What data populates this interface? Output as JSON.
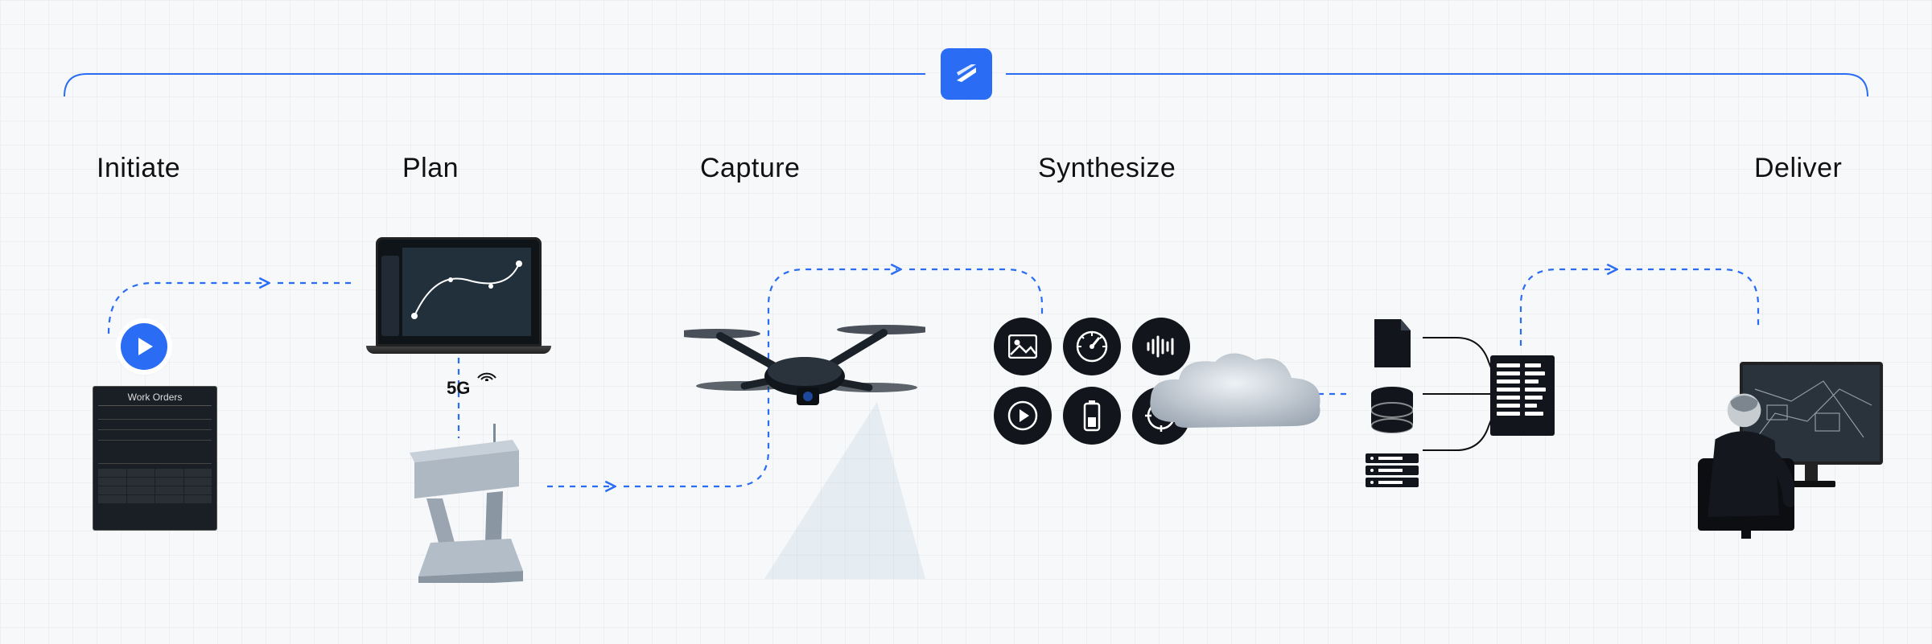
{
  "brand": {
    "accent_color": "#2a6df4",
    "logo_name": "brand-logo"
  },
  "connector": {
    "color": "#2a6df4",
    "style": "dashed"
  },
  "stages": {
    "initiate": {
      "label": "Initiate"
    },
    "plan": {
      "label": "Plan"
    },
    "capture": {
      "label": "Capture"
    },
    "synthesize": {
      "label": "Synthesize"
    },
    "deliver": {
      "label": "Deliver"
    }
  },
  "initiate": {
    "trigger_button": "play",
    "document_title": "Work Orders"
  },
  "plan": {
    "device": "laptop",
    "map_content": "flight-route",
    "network_label": "5G",
    "ground_station": "docking-station"
  },
  "capture": {
    "vehicle": "quadcopter-drone",
    "sensor_beam": true
  },
  "synthesize": {
    "data_icons": [
      "image-icon",
      "gauge-icon",
      "waveform-icon",
      "play-icon",
      "battery-icon",
      "target-icon"
    ],
    "compute": "cloud",
    "storage_stack": [
      "document-icon",
      "database-icon",
      "server-icon"
    ],
    "output": "report"
  },
  "deliver": {
    "recipient": "operator-at-workstation"
  }
}
